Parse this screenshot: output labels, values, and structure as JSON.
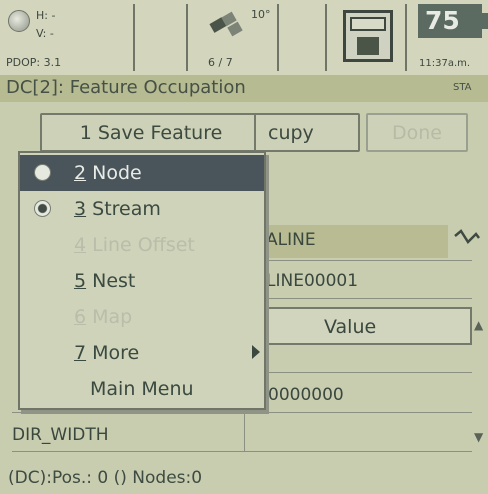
{
  "status_bar": {
    "gps_h": "H: -",
    "gps_v": "V: -",
    "pdop": "PDOP: 3.1",
    "satellite_angle": "10°",
    "satellite_count": "6 / 7",
    "battery": "75",
    "time": "11:37a.m."
  },
  "title": {
    "text": "DC[2]: Feature Occupation",
    "right": "STA"
  },
  "buttons": {
    "save_feature": "1 Save Feature",
    "occupy": "cupy",
    "done": "Done"
  },
  "form": {
    "code_value": "ALINE",
    "name_value": "LINE00001",
    "col_header": "Value",
    "row_value_2": "0000000",
    "attribute_label": "DIR_WIDTH"
  },
  "menu": {
    "items": [
      {
        "num": "2",
        "label": " Node",
        "state": "selected",
        "radio": "empty"
      },
      {
        "num": "3",
        "label": " Stream",
        "state": "normal",
        "radio": "checked"
      },
      {
        "num": "4",
        "label": " Line Offset",
        "state": "disabled",
        "radio": "none"
      },
      {
        "num": "5",
        "label": " Nest",
        "state": "normal",
        "radio": "none"
      },
      {
        "num": "6",
        "label": " Map",
        "state": "disabled",
        "radio": "none"
      },
      {
        "num": "7",
        "label": " More",
        "state": "normal",
        "radio": "none",
        "submenu": true
      },
      {
        "num": "",
        "label": "Main Menu",
        "state": "normal",
        "radio": "none"
      }
    ]
  },
  "bottom_status": "(DC):Pos.: 0 () Nodes:0"
}
